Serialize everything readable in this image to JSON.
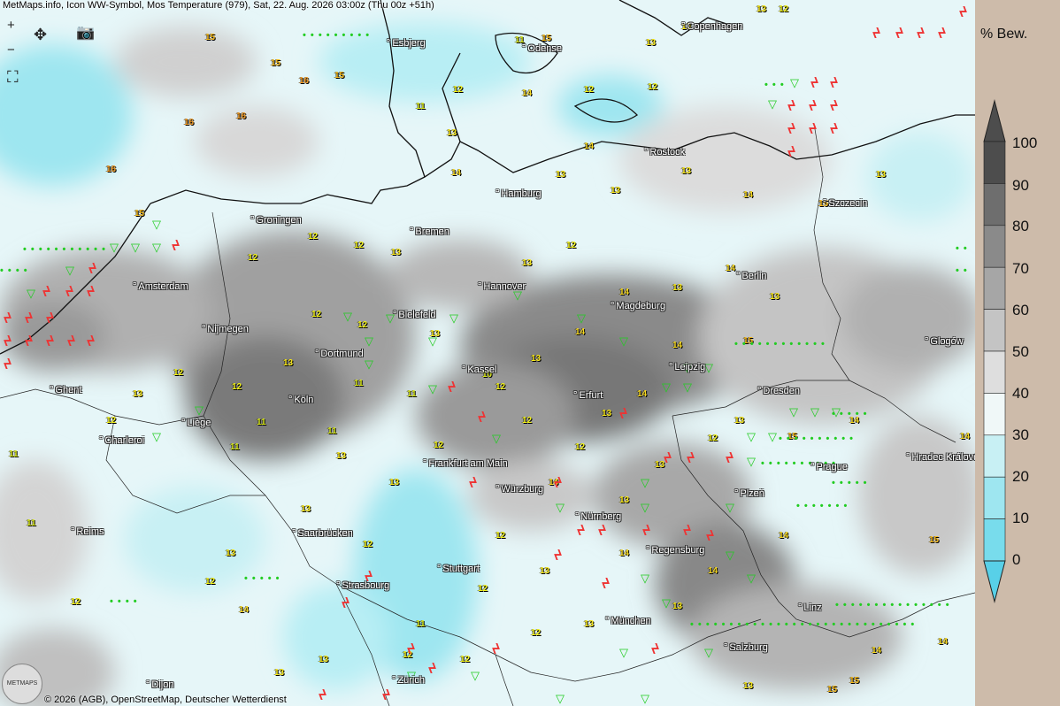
{
  "header": {
    "title": "MetMaps.info, Icon WW-Symbol, Mos Temperature (979), Sat, 22. Aug. 2026 03:00z (Thu 00z +51h)"
  },
  "controls": {
    "zoom_in": "+",
    "zoom_out": "−",
    "pan": "✥",
    "camera": "📷",
    "fullscreen": "⛶"
  },
  "cities": [
    {
      "name": "Esbjerg"
    },
    {
      "name": "Odense"
    },
    {
      "name": "Copenhagen"
    },
    {
      "name": "Rostock"
    },
    {
      "name": "Hamburg"
    },
    {
      "name": "Szczecin"
    },
    {
      "name": "Groningen"
    },
    {
      "name": "Bremen"
    },
    {
      "name": "Amsterdam"
    },
    {
      "name": "Berlin"
    },
    {
      "name": "Hannover"
    },
    {
      "name": "Magdeburg"
    },
    {
      "name": "Bielefeld"
    },
    {
      "name": "Nijmegen"
    },
    {
      "name": "Glogów"
    },
    {
      "name": "Dortmund"
    },
    {
      "name": "Kassel"
    },
    {
      "name": "Leipzig"
    },
    {
      "name": "Ghent"
    },
    {
      "name": "Köln"
    },
    {
      "name": "Erfurt"
    },
    {
      "name": "Dresden"
    },
    {
      "name": "Liège"
    },
    {
      "name": "Charleroi"
    },
    {
      "name": "Frankfurt am Main"
    },
    {
      "name": "Hradec Králové"
    },
    {
      "name": "Prague"
    },
    {
      "name": "Würzburg"
    },
    {
      "name": "Plzeň"
    },
    {
      "name": "Reims"
    },
    {
      "name": "Nürnberg"
    },
    {
      "name": "Saarbrücken"
    },
    {
      "name": "Stuttgart"
    },
    {
      "name": "Regensburg"
    },
    {
      "name": "Strasbourg"
    },
    {
      "name": "Linz"
    },
    {
      "name": "München"
    },
    {
      "name": "Salzburg"
    },
    {
      "name": "Zürich"
    },
    {
      "name": "Dijon"
    }
  ],
  "legend": {
    "title": "% Bew.",
    "labels": [
      "100",
      "90",
      "80",
      "70",
      "60",
      "50",
      "40",
      "30",
      "20",
      "10",
      "0"
    ],
    "colors": [
      "#4d4d4d",
      "#6e6e6e",
      "#8a8a8a",
      "#a6a6a6",
      "#c4c4c4",
      "#dedede",
      "#f0f8f8",
      "#c8f0f4",
      "#9ee6f0",
      "#78dcec",
      "#58d0e8"
    ]
  },
  "footer": {
    "copyright": "© 2026 (AGB), OpenStreetMap, Deutscher Wetterdienst",
    "logo": "METMAPS"
  },
  "temperatures": [
    "15",
    "16",
    "15",
    "12",
    "15",
    "13",
    "12",
    "16",
    "14",
    "15",
    "16",
    "15",
    "16",
    "13",
    "11",
    "12",
    "11",
    "12",
    "13",
    "13",
    "14",
    "14",
    "13",
    "13",
    "13",
    "14",
    "15",
    "12",
    "12",
    "13",
    "13",
    "12",
    "14",
    "13",
    "13",
    "14",
    "12",
    "12",
    "13",
    "14",
    "15",
    "14",
    "13",
    "13",
    "12",
    "12",
    "11",
    "12",
    "11",
    "10",
    "12",
    "13",
    "14",
    "13",
    "13",
    "12",
    "12",
    "12",
    "13",
    "11",
    "11",
    "13",
    "14",
    "15",
    "15",
    "13",
    "13",
    "12",
    "11",
    "12",
    "12",
    "13",
    "14",
    "14",
    "14",
    "13",
    "13",
    "12",
    "11",
    "12",
    "13",
    "14",
    "15",
    "15",
    "14",
    "14",
    "13",
    "13",
    "12",
    "12",
    "12",
    "11",
    "11",
    "12",
    "13",
    "13",
    "14",
    "14",
    "13",
    "12"
  ]
}
